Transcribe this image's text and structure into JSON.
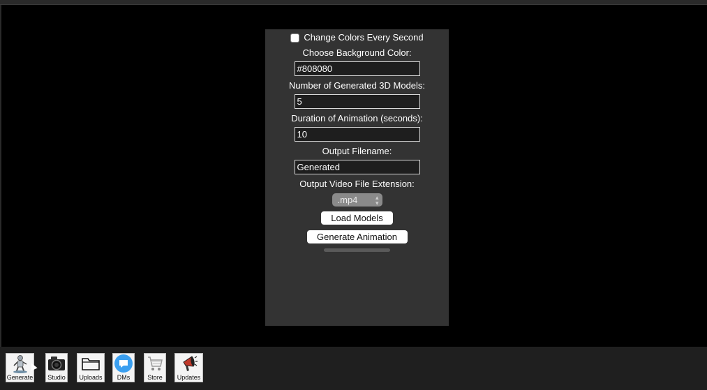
{
  "form": {
    "change_colors_label": "Change Colors Every Second",
    "change_colors_checked": false,
    "bg_color_label": "Choose Background Color:",
    "bg_color_value": "#808080",
    "num_models_label": "Number of Generated 3D Models:",
    "num_models_value": "5",
    "duration_label": "Duration of Animation (seconds):",
    "duration_value": "10",
    "filename_label": "Output Filename:",
    "filename_value": "Generated",
    "extension_label": "Output Video File Extension:",
    "extension_value": ".mp4",
    "load_models_label": "Load Models",
    "generate_animation_label": "Generate Animation",
    "progress": 0
  },
  "taskbar": {
    "items": [
      {
        "label": "Generate",
        "icon": "robot-figure-icon"
      },
      {
        "label": "Studio",
        "icon": "camera-icon"
      },
      {
        "label": "Uploads",
        "icon": "folder-icon"
      },
      {
        "label": "DMs",
        "icon": "chat-bubble-icon"
      },
      {
        "label": "Store",
        "icon": "shopping-cart-icon"
      },
      {
        "label": "Updates",
        "icon": "megaphone-icon"
      }
    ]
  },
  "colors": {
    "panel_bg": "#333333",
    "app_bg": "#000000",
    "taskbar_bg": "#1f1f1f",
    "dm_icon": "#3a9ff0",
    "megaphone": "#c0392b"
  }
}
